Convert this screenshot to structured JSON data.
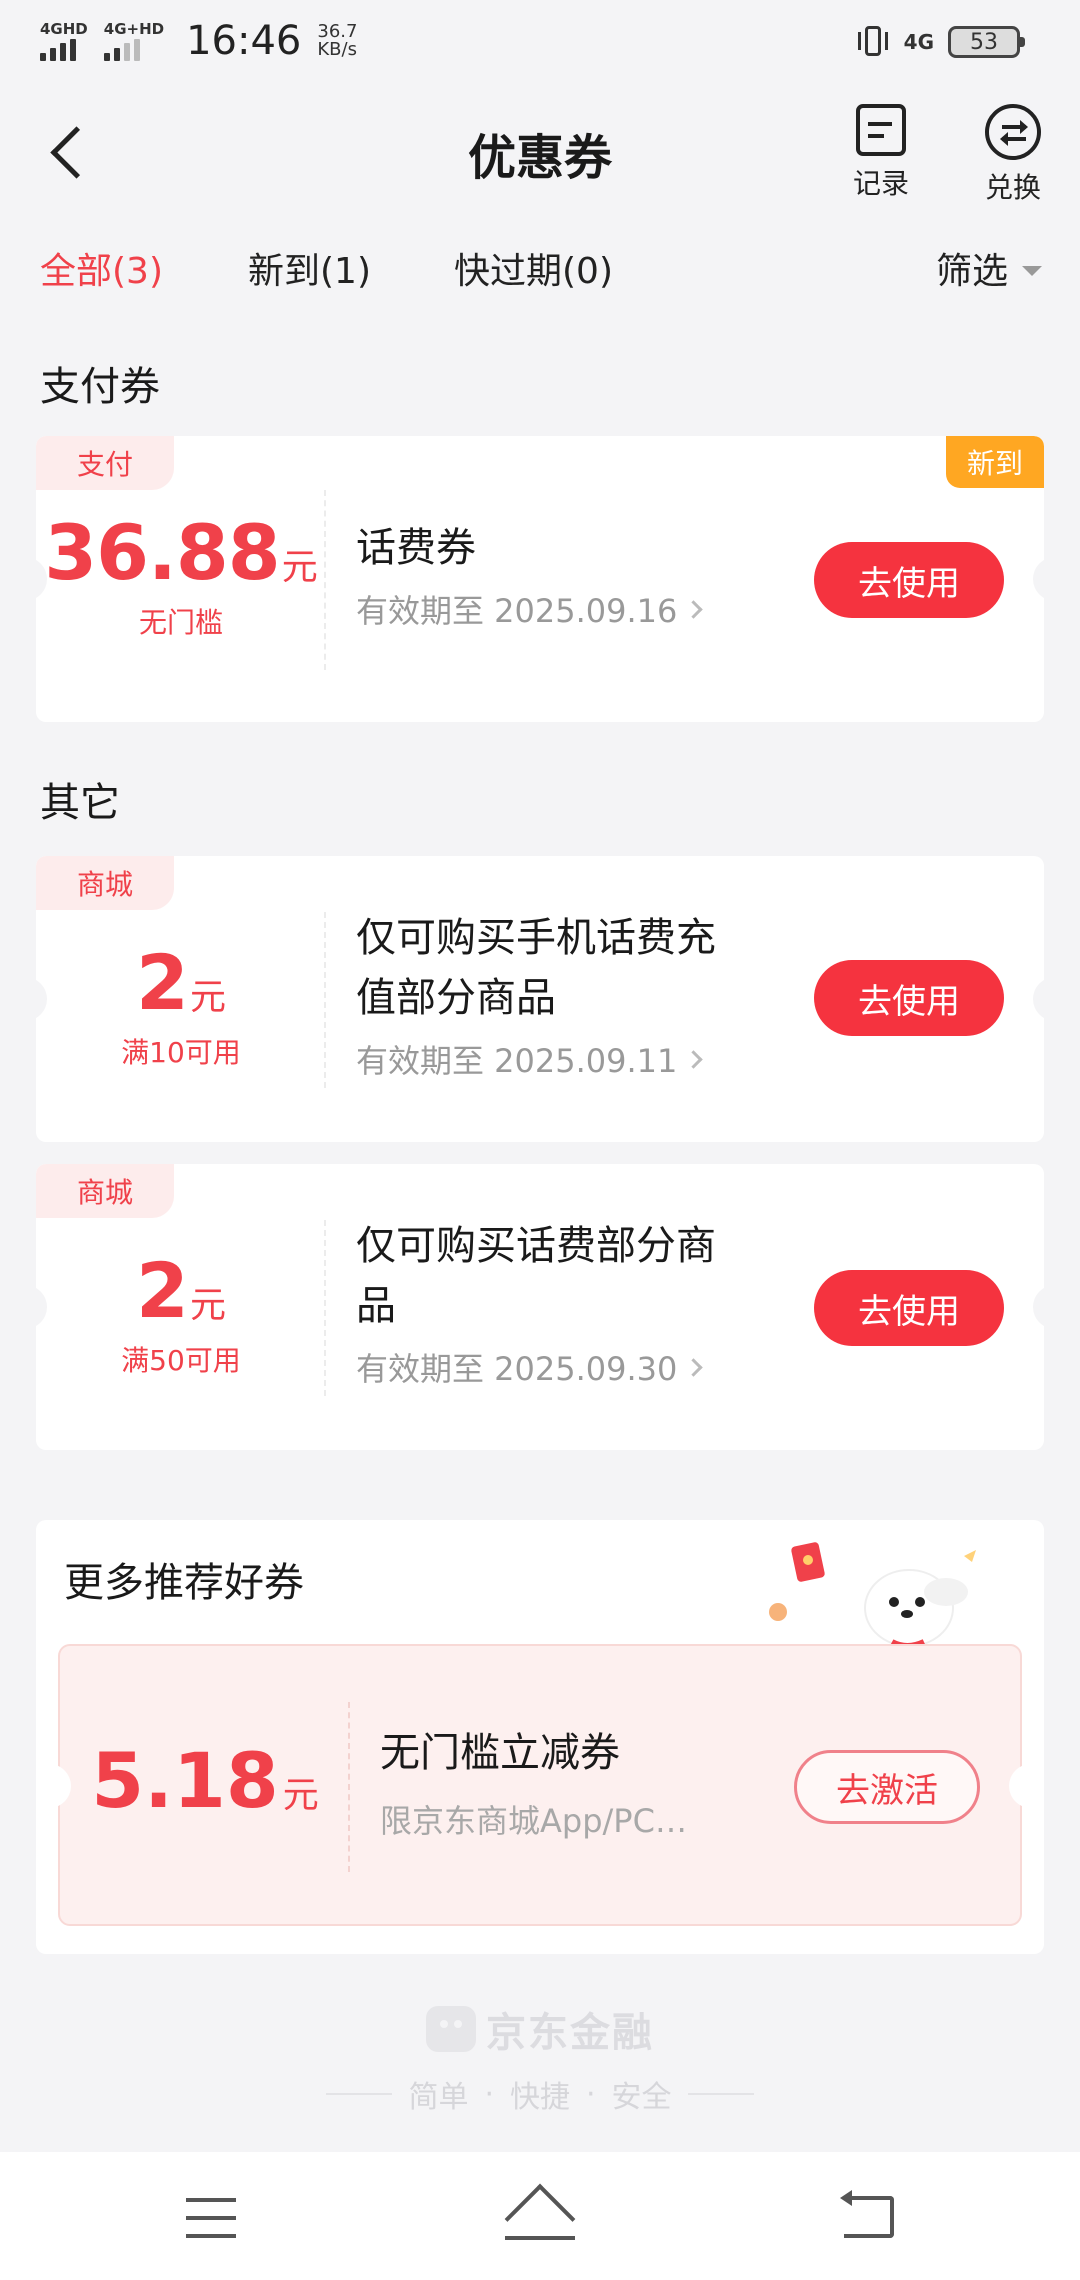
{
  "status_bar": {
    "sim1": "4GHD",
    "sim2": "4G+HD",
    "time": "16:46",
    "net_speed_value": "36.7",
    "net_speed_unit": "KB/s",
    "data_type": "4G",
    "battery": "53"
  },
  "header": {
    "title": "优惠券",
    "record_label": "记录",
    "exchange_label": "兑换"
  },
  "tabs": [
    {
      "label": "全部(3)",
      "active": true
    },
    {
      "label": "新到(1)",
      "active": false
    },
    {
      "label": "快过期(0)",
      "active": false
    }
  ],
  "filter_label": "筛选",
  "sections": {
    "payment": "支付券",
    "other": "其它"
  },
  "coupons": [
    {
      "tag": "支付",
      "new_badge": "新到",
      "amount": "36.88",
      "unit": "元",
      "condition": "无门槛",
      "name_line1": "话费券",
      "name_line2": "",
      "expiry": "有效期至 2025.09.16",
      "button": "去使用"
    },
    {
      "tag": "商城",
      "amount": "2",
      "unit": "元",
      "condition": "满10可用",
      "name_line1": "仅可购买手机话费充",
      "name_line2": "值部分商品",
      "expiry": "有效期至 2025.09.11",
      "button": "去使用"
    },
    {
      "tag": "商城",
      "amount": "2",
      "unit": "元",
      "condition": "满50可用",
      "name_line1": "仅可购买话费部分商",
      "name_line2": "品",
      "expiry": "有效期至 2025.09.30",
      "button": "去使用"
    }
  ],
  "recommend": {
    "title": "更多推荐好券",
    "amount": "5.18",
    "unit": "元",
    "name": "无门槛立减券",
    "desc": "限京东商城App/PC…",
    "button": "去激活"
  },
  "footer": {
    "brand": "京东金融",
    "slogan": [
      "简单",
      "快捷",
      "安全"
    ],
    "separator": "·"
  },
  "colors": {
    "accent": "#f0414a",
    "button": "#f5333f",
    "new_badge": "#ffa722",
    "background": "#f4f4f6"
  }
}
